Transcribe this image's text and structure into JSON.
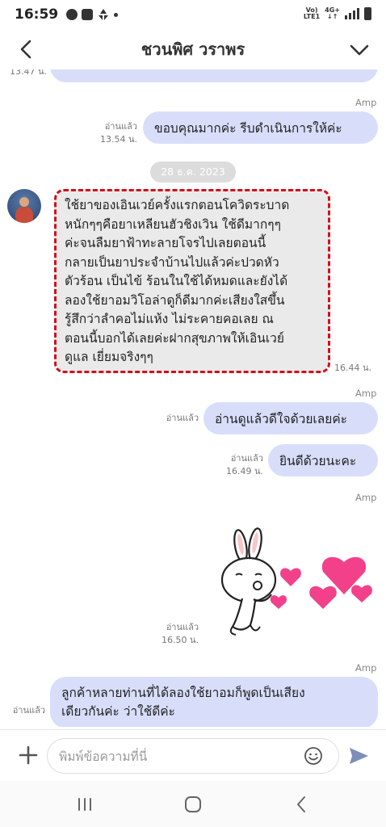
{
  "status_bar": {
    "time": "16:59",
    "volte": "Vo)",
    "lte": "LTE1",
    "network": "4G+"
  },
  "header": {
    "title": "ชวนพิศ วราพร"
  },
  "chat": {
    "partial_top_time": "13.47 น.",
    "messages": [
      {
        "sender": "Amp",
        "text": "ขอบคุณมากค่ะ รีบดำเนินการให้ค่ะ",
        "read": "อ่านแล้ว",
        "time": "13.54 น."
      }
    ],
    "date_separator": "28 ธ.ค. 2023",
    "incoming": {
      "lines": [
        "ใช้ยาของเอินเวย์ครั้งแรกตอนโควิดระบาด",
        "หนักๆๆคือยาเหลียนฮัวชิงเวิน ใช้ดีมากๆๆ",
        "ค่ะจนลืมยาฟ้าทะลายโจรไปเลยตอนนี้",
        "กลายเป็นยาประจำบ้านไปแล้วค่ะปวดหัว",
        "ตัวร้อน เป็นไข้ ร้อนในใช้ได้หมดและยังได้",
        "ลองใช้ยาอมวิโอล่าดูก็ดีมากค่ะเสียงใสขึ้น",
        "รู้สึกว่าลำคอไม่แห้ง ไม่ระคายคอเลย ณ",
        "ตอนนี้บอกได้เลยค่ะฝากสุขภาพให้เอินเวย์",
        "ดูแล เยี่ยมจริงๆๆ"
      ],
      "time": "16.44 น."
    },
    "reply1": {
      "sender": "Amp",
      "text": "อ่านดูแล้วดีใจด้วยเลยค่ะ",
      "read": "อ่านแล้ว"
    },
    "reply2": {
      "text": "ยินดีด้วยนะคะ",
      "read": "อ่านแล้ว",
      "time": "16.49 น."
    },
    "sticker": {
      "sender": "Amp",
      "read": "อ่านแล้ว",
      "time": "16.50 น."
    },
    "reply3": {
      "sender": "Amp",
      "line1": "ลูกค้าหลายท่านที่ได้ลองใช้ยาอมก็พูดเป็นเสียง",
      "line2": "เดียวกันค่ะ ว่าใช้ดีค่ะ",
      "read": "อ่านแล้ว"
    }
  },
  "input": {
    "placeholder": "พิมพ์ข้อความที่นี่"
  },
  "colors": {
    "outgoing_bubble": "#d8defa",
    "incoming_bubble": "#eaeaea",
    "highlight_border": "#d0101c",
    "send_icon": "#7d8fb8"
  }
}
